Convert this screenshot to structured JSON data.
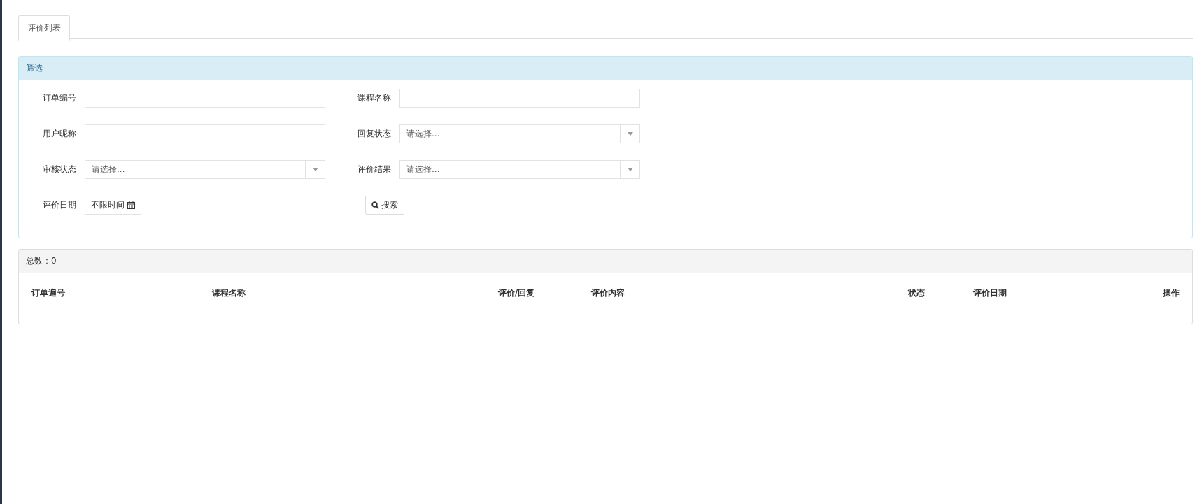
{
  "tabs": [
    {
      "label": "评价列表",
      "selected": true
    }
  ],
  "filter": {
    "title": "筛选",
    "fields": [
      {
        "kind": "text",
        "label": "订单编号"
      },
      {
        "kind": "text",
        "label": "课程名称"
      },
      {
        "kind": "text",
        "label": "用户昵称"
      },
      {
        "kind": "select",
        "label": "回复状态",
        "placeholder": "请选择..."
      },
      {
        "kind": "select",
        "label": "审核状态",
        "placeholder": "请选择..."
      },
      {
        "kind": "select",
        "label": "评价结果",
        "placeholder": "请选择..."
      },
      {
        "kind": "date",
        "label": "评价日期",
        "value": "不限时间"
      }
    ],
    "search_button": "搜索"
  },
  "table": {
    "total": "总数：0",
    "columns": [
      "订单遍号",
      "课程名称",
      "评价/回复",
      "评价内容",
      "状态",
      "评价日期",
      "操作"
    ]
  }
}
